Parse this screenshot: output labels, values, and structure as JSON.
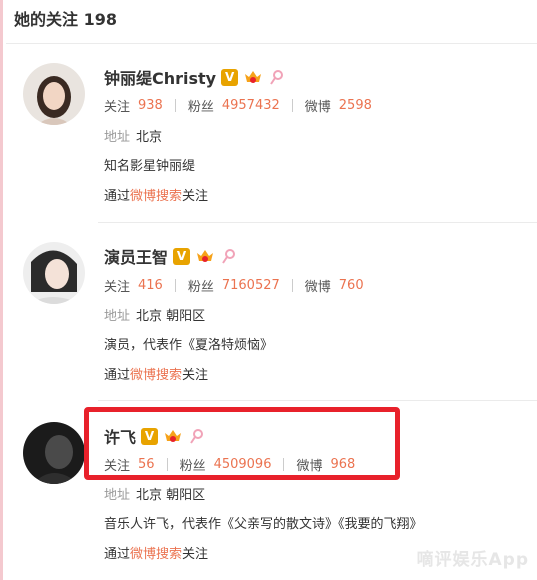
{
  "header": {
    "title": "她的关注 198"
  },
  "users": [
    {
      "name": "钟丽缇Christy",
      "follow_label": "关注",
      "follow_count": "938",
      "fans_label": "粉丝",
      "fans_count": "4957432",
      "weibo_label": "微博",
      "weibo_count": "2598",
      "addr_label": "地址",
      "addr_value": "北京",
      "desc": "知名影星钟丽缇",
      "via_prefix": "通过",
      "via_link": "微博搜索",
      "via_suffix": "关注"
    },
    {
      "name": "演员王智",
      "follow_label": "关注",
      "follow_count": "416",
      "fans_label": "粉丝",
      "fans_count": "7160527",
      "weibo_label": "微博",
      "weibo_count": "760",
      "addr_label": "地址",
      "addr_value": "北京 朝阳区",
      "desc": "演员，代表作《夏洛特烦恼》",
      "via_prefix": "通过",
      "via_link": "微博搜索",
      "via_suffix": "关注"
    },
    {
      "name": "许飞",
      "follow_label": "关注",
      "follow_count": "56",
      "fans_label": "粉丝",
      "fans_count": "4509096",
      "weibo_label": "微博",
      "weibo_count": "968",
      "addr_label": "地址",
      "addr_value": "北京 朝阳区",
      "desc": "音乐人许飞，代表作《父亲写的散文诗》《我要的飞翔》",
      "via_prefix": "通过",
      "via_link": "微博搜索",
      "via_suffix": "关注"
    }
  ],
  "badges": {
    "verified_letter": "V"
  },
  "watermark": "嘀评娱乐App",
  "colors": {
    "accent": "#eb7350",
    "highlight_box": "#e8212b",
    "verified": "#e8a300"
  }
}
